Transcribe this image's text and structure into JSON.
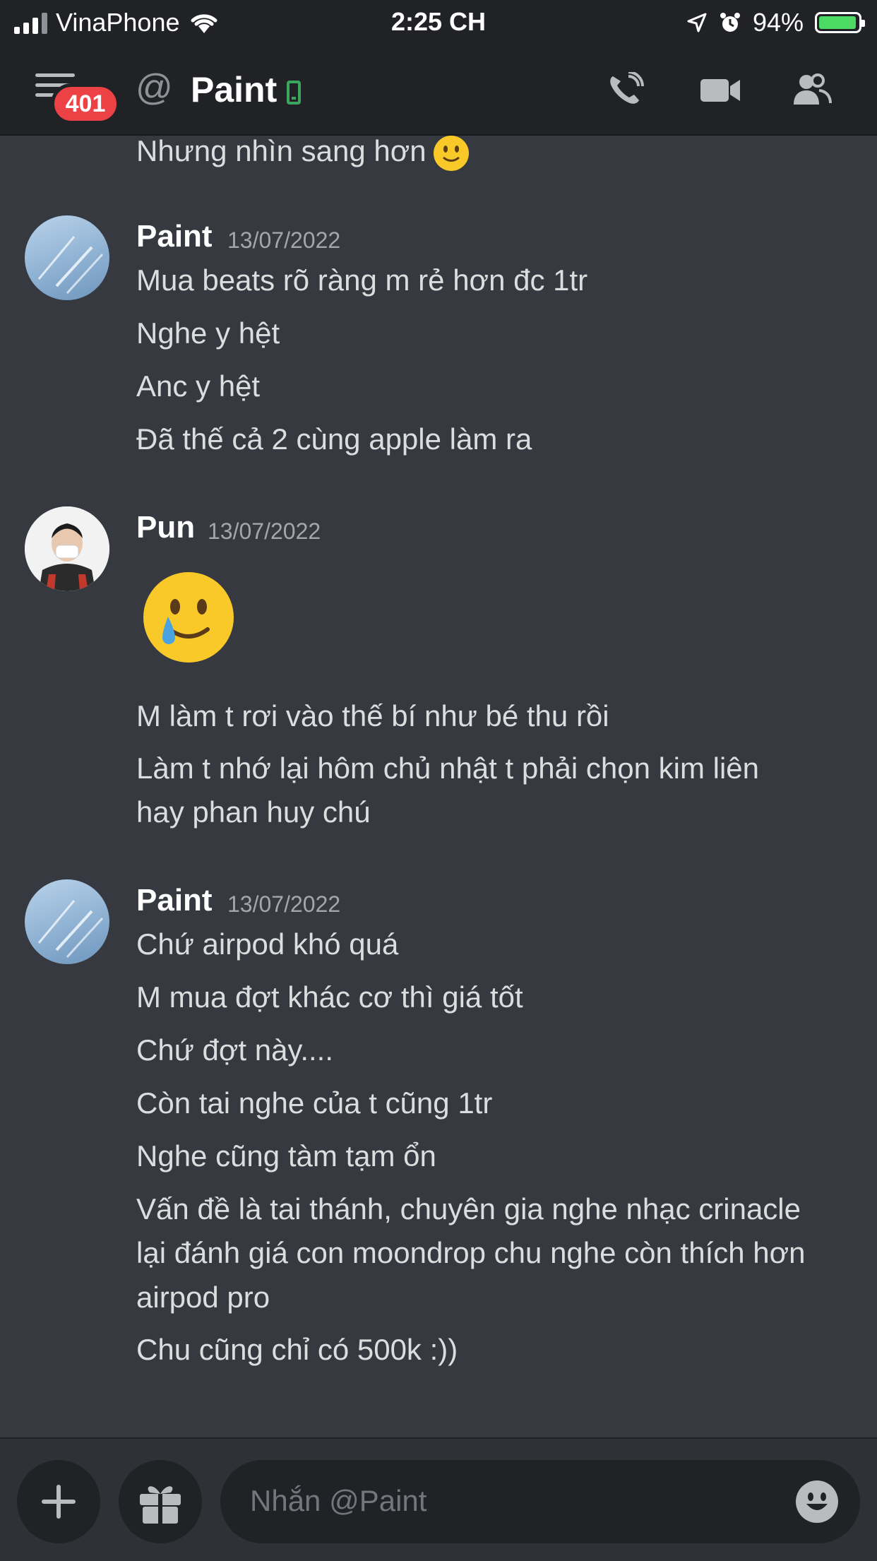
{
  "status_bar": {
    "carrier": "VinaPhone",
    "time": "2:25 CH",
    "battery": "94%"
  },
  "header": {
    "badge": "401",
    "title": "Paint"
  },
  "messages": [
    {
      "continuation": true,
      "lines": [
        "Nhưng nhìn sang hơn"
      ]
    },
    {
      "author": "Paint",
      "timestamp": "13/07/2022",
      "lines": [
        "Mua beats rõ ràng m rẻ hơn đc 1tr",
        "Nghe y hệt",
        "Anc y hệt",
        "Đã thế cả 2 cùng apple làm ra"
      ]
    },
    {
      "author": "Pun",
      "timestamp": "13/07/2022",
      "lines": [
        "M làm t rơi vào thế bí như bé thu rồi",
        "Làm t nhớ lại hôm chủ nhật t phải chọn kim liên",
        "hay phan huy chú"
      ]
    },
    {
      "author": "Paint",
      "timestamp": "13/07/2022",
      "lines": [
        "Chứ airpod khó quá",
        "M mua đợt khác cơ thì giá tốt",
        "Chứ đợt này....",
        "Còn tai nghe của t cũng 1tr",
        "Nghe cũng tàm tạm ổn",
        "Vấn đề là tai thánh, chuyên gia nghe nhạc crinacle",
        "lại đánh giá con moondrop chu nghe còn thích hơn",
        "airpod pro",
        "Chu cũng chỉ có 500k :))"
      ]
    }
  ],
  "composer": {
    "placeholder": "Nhắn @Paint"
  },
  "icons": {
    "menu": "hamburger-icon",
    "at": "at-icon",
    "mobile_status": "mobile-phone-icon",
    "call": "phone-call-icon",
    "video": "video-camera-icon",
    "members": "members-icon",
    "add": "plus-icon",
    "gift": "gift-icon",
    "emoji": "emoji-icon"
  },
  "colors": {
    "background": "#36393f",
    "header": "#202225",
    "badge": "#ed4245",
    "online_mobile": "#3ba55d",
    "text": "#dcddde"
  }
}
